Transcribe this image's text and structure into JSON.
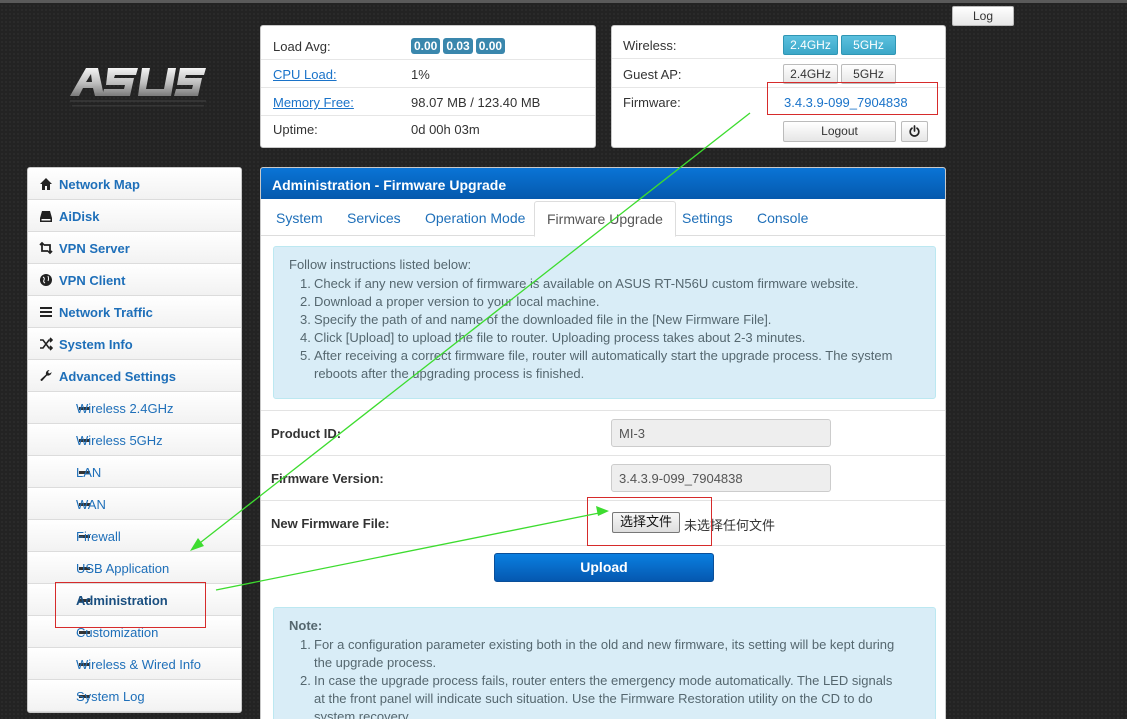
{
  "header": {
    "log_label": "Log"
  },
  "status": {
    "load_avg_label": "Load Avg:",
    "load_avg_values": [
      "0.00",
      "0.03",
      "0.00"
    ],
    "cpu_label": "CPU Load:",
    "cpu_value": "1%",
    "memory_label": "Memory Free:",
    "memory_value": "98.07 MB / 123.40 MB",
    "uptime_label": "Uptime:",
    "uptime_value": "0d 00h 03m"
  },
  "wireless": {
    "wireless_label": "Wireless:",
    "guest_label": "Guest AP:",
    "firmware_label": "Firmware:",
    "btn_24": "2.4GHz",
    "btn_5": "5GHz",
    "firmware_value": "3.4.3.9-099_7904838",
    "logout_label": "Logout"
  },
  "sidebar": {
    "items": [
      {
        "label": "Network Map",
        "icon": "home-icon"
      },
      {
        "label": "AiDisk",
        "icon": "hdd-icon"
      },
      {
        "label": "VPN Server",
        "icon": "retweet-icon"
      },
      {
        "label": "VPN Client",
        "icon": "globe-icon"
      },
      {
        "label": "Network Traffic",
        "icon": "list-icon"
      },
      {
        "label": "System Info",
        "icon": "random-icon"
      },
      {
        "label": "Advanced Settings",
        "icon": "wrench-icon"
      }
    ],
    "sub_items": [
      "Wireless 2.4GHz",
      "Wireless 5GHz",
      "LAN",
      "WAN",
      "Firewall",
      "USB Application",
      "Administration",
      "Customization",
      "Wireless & Wired Info",
      "System Log"
    ]
  },
  "main": {
    "title": "Administration - Firmware Upgrade",
    "tabs": [
      "System",
      "Services",
      "Operation Mode",
      "Firmware Upgrade",
      "Settings",
      "Console"
    ],
    "instructions_head": "Follow instructions listed below:",
    "instructions": [
      {
        "num": "1.",
        "lines": [
          "Check if any new version of firmware is available on ASUS RT-N56U custom firmware website."
        ]
      },
      {
        "num": "2.",
        "lines": [
          "Download a proper version to your local machine."
        ]
      },
      {
        "num": "3.",
        "lines": [
          "Specify the path of and name of the downloaded file in the [New Firmware File]."
        ]
      },
      {
        "num": "4.",
        "lines": [
          "Click [Upload] to upload the file to router. Uploading process takes about 2-3 minutes."
        ]
      },
      {
        "num": "5.",
        "lines": [
          "After receiving a correct firmware file, router will automatically start the upgrade process. The system",
          "reboots after the upgrading process is finished."
        ]
      }
    ],
    "product_id_label": "Product ID:",
    "product_id_value": "MI-3",
    "fw_version_label": "Firmware Version:",
    "fw_version_value": "3.4.3.9-099_7904838",
    "new_fw_label": "New Firmware File:",
    "file_button": "选择文件",
    "file_status": "未选择任何文件",
    "upload_label": "Upload",
    "note_head": "Note:",
    "notes": [
      {
        "num": "1.",
        "lines": [
          "For a configuration parameter existing both in the old and new firmware, its setting will be kept during",
          "the upgrade process."
        ]
      },
      {
        "num": "2.",
        "lines": [
          "In case the upgrade process fails, router enters the emergency mode automatically. The LED signals",
          "at the front panel will indicate such situation. Use the Firmware Restoration utility on the CD to do",
          "system recovery."
        ]
      }
    ]
  },
  "colors": {
    "brand_blue": "#0a74d6",
    "link_blue": "#1e6fb9",
    "annotation_red": "#d62b2b",
    "annotation_green": "#3ddc2f"
  }
}
